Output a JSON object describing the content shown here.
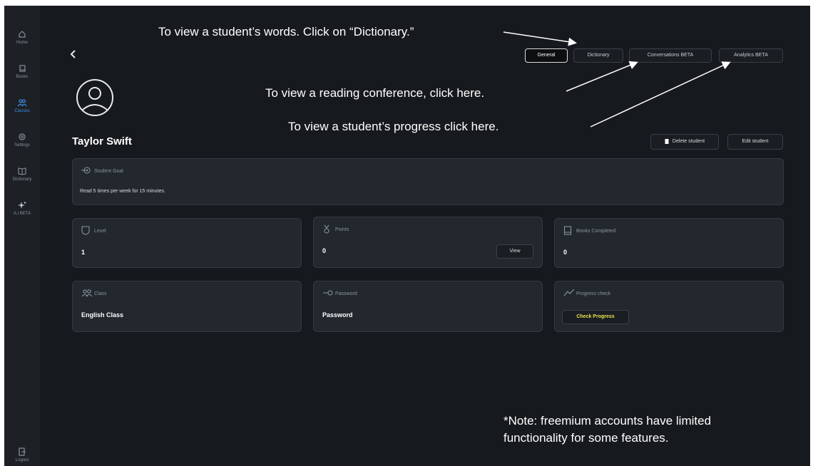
{
  "sidebar": {
    "items": [
      {
        "label": "Home",
        "icon": "home-icon"
      },
      {
        "label": "Books",
        "icon": "book-icon"
      },
      {
        "label": "Classes",
        "icon": "users-icon",
        "active": true
      },
      {
        "label": "Settings",
        "icon": "gear-icon"
      },
      {
        "label": "Dictionary",
        "icon": "dictionary-icon"
      },
      {
        "label": "A.I BETA",
        "icon": "sparkle-icon"
      }
    ],
    "logout": {
      "label": "Logout",
      "icon": "logout-icon"
    }
  },
  "header": {
    "back_icon": "chevron-left-icon",
    "tabs": [
      {
        "label": "General",
        "active": true
      },
      {
        "label": "Dictionary"
      },
      {
        "label": "Conversations BETA"
      },
      {
        "label": "Analytics BETA"
      }
    ]
  },
  "student": {
    "name": "Taylor Swift",
    "delete_label": "Delete student",
    "edit_label": "Edit student"
  },
  "goal": {
    "label": "Student Goal",
    "text": "Read 5 times per week for 15 minutes."
  },
  "cards": {
    "level": {
      "label": "Level",
      "value": "1"
    },
    "points": {
      "label": "Points",
      "value": "0",
      "button": "View"
    },
    "books": {
      "label": "Books Completed",
      "value": "0"
    },
    "class": {
      "label": "Class",
      "value": "English Class"
    },
    "password": {
      "label": "Password",
      "value": "Password"
    },
    "progress": {
      "label": "Progress check",
      "button": "Check Progress"
    }
  },
  "annotations": {
    "dictionary": "To view a student’s words. Click on “Dictionary.”",
    "conference": "To view a reading conference, click here.",
    "progress": "To view a student’s progress click here.",
    "note_line1": "*Note: freemium accounts have limited",
    "note_line2": "functionality for some features."
  },
  "colors": {
    "background": "#16191d",
    "card": "#23282e",
    "accent": "#3e8ae0",
    "highlight": "#e9e24a"
  }
}
